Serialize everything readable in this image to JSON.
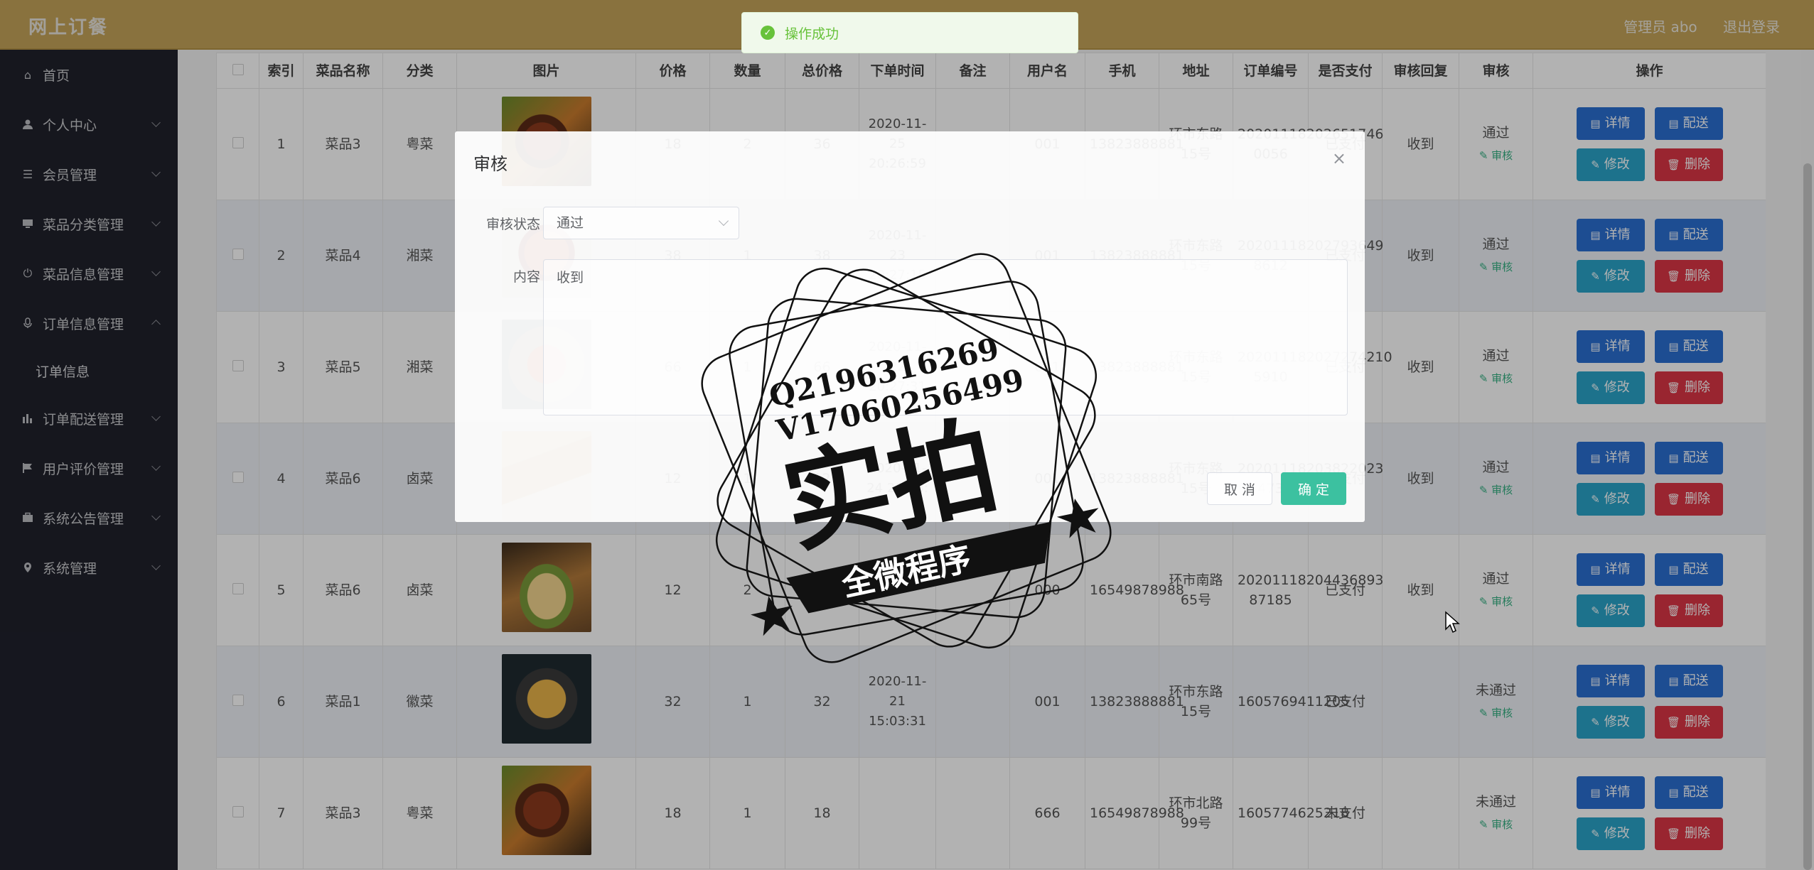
{
  "header": {
    "brand": "网上订餐",
    "admin": "管理员 abo",
    "logout": "退出登录"
  },
  "sidebar": {
    "items": [
      {
        "label": "首页",
        "icon": "home-icon"
      },
      {
        "label": "个人中心",
        "icon": "user-icon"
      },
      {
        "label": "会员管理",
        "icon": "list-icon"
      },
      {
        "label": "菜品分类管理",
        "icon": "monitor-icon"
      },
      {
        "label": "菜品信息管理",
        "icon": "power-icon"
      },
      {
        "label": "订单信息管理",
        "icon": "mic-icon"
      },
      {
        "label": "订单配送管理",
        "icon": "bar-chart-icon"
      },
      {
        "label": "用户评价管理",
        "icon": "flag-icon"
      },
      {
        "label": "系统公告管理",
        "icon": "briefcase-icon"
      },
      {
        "label": "系统管理",
        "icon": "location-icon"
      }
    ],
    "sub_item": "订单信息"
  },
  "table": {
    "headers": [
      "",
      "索引",
      "菜品名称",
      "分类",
      "图片",
      "价格",
      "数量",
      "总价格",
      "下单时间",
      "备注",
      "用户名",
      "手机",
      "地址",
      "订单编号",
      "是否支付",
      "审核回复",
      "审核",
      "操作"
    ],
    "rows": [
      {
        "idx": "1",
        "name": "菜品3",
        "cat": "粤菜",
        "price": "18",
        "qty": "2",
        "total": "36",
        "time": "2020-11-25 20:26:59",
        "note": "",
        "user": "001",
        "phone": "13823888881",
        "addr": "环市东路15号",
        "order_no": "20201118202651746 0056",
        "paid": "已支付",
        "reply": "收到",
        "audit": "通过",
        "img": "steak"
      },
      {
        "idx": "2",
        "name": "菜品4",
        "cat": "湘菜",
        "price": "38",
        "qty": "1",
        "total": "38",
        "time": "2020-11-23 20:27:15",
        "note": "",
        "user": "001",
        "phone": "13823888881",
        "addr": "环市东路15号",
        "order_no": "20201118202793649 8612",
        "paid": "已支付",
        "reply": "收到",
        "audit": "通过",
        "img": "soup"
      },
      {
        "idx": "3",
        "name": "菜品5",
        "cat": "湘菜",
        "price": "66",
        "qty": "1",
        "total": "66",
        "time": "2020-11-22 20:27:31",
        "note": "",
        "user": "001",
        "phone": "13823888881",
        "addr": "环市东路15号",
        "order_no": "202011182027274210 5910",
        "paid": "已支付",
        "reply": "收到",
        "audit": "通过",
        "img": "crab"
      },
      {
        "idx": "4",
        "name": "菜品6",
        "cat": "卤菜",
        "price": "12",
        "qty": "1",
        "total": "12",
        "time": "2020-11-24 20:38:",
        "note": "",
        "user": "001",
        "phone": "13823888881",
        "addr": "环市东路15号",
        "order_no": "20201118203822023 473",
        "paid": "已支付",
        "reply": "收到",
        "audit": "通过",
        "img": "taco"
      },
      {
        "idx": "5",
        "name": "菜品6",
        "cat": "卤菜",
        "price": "12",
        "qty": "2",
        "total": "24",
        "time": "",
        "note": "",
        "user": "000",
        "phone": "16549878988",
        "addr": "环市南路65号",
        "order_no": "20201118204436893 87185",
        "paid": "已支付",
        "reply": "收到",
        "audit": "通过",
        "img": "taco2"
      },
      {
        "idx": "6",
        "name": "菜品1",
        "cat": "徽菜",
        "price": "32",
        "qty": "1",
        "total": "32",
        "time": "2020-11-21 15:03:31",
        "note": "",
        "user": "001",
        "phone": "13823888881",
        "addr": "环市东路15号",
        "order_no": "1605769411205",
        "paid": "已支付",
        "reply": "",
        "audit": "未通过",
        "img": "plate"
      },
      {
        "idx": "7",
        "name": "菜品3",
        "cat": "粤菜",
        "price": "18",
        "qty": "1",
        "total": "18",
        "time": "",
        "note": "",
        "user": "666",
        "phone": "16549878988",
        "addr": "环市北路99号",
        "order_no": "1605774625218",
        "paid": "未支付",
        "reply": "",
        "audit": "未通过",
        "img": "steak"
      }
    ],
    "audit_link": "审核",
    "btn_detail": "详情",
    "btn_send": "配送",
    "btn_edit": "修改",
    "btn_del": "删除"
  },
  "modal": {
    "title": "审核",
    "close": "×",
    "status_label": "审核状态",
    "status_value": "通过",
    "content_label": "内容",
    "content_value": "收到",
    "cancel": "取 消",
    "ok": "确 定"
  },
  "toast": {
    "text": "操作成功"
  },
  "watermark": {
    "line1": "Q2196316269",
    "line2": "V17060256499",
    "big": "实拍",
    "banner": "全微程序"
  }
}
